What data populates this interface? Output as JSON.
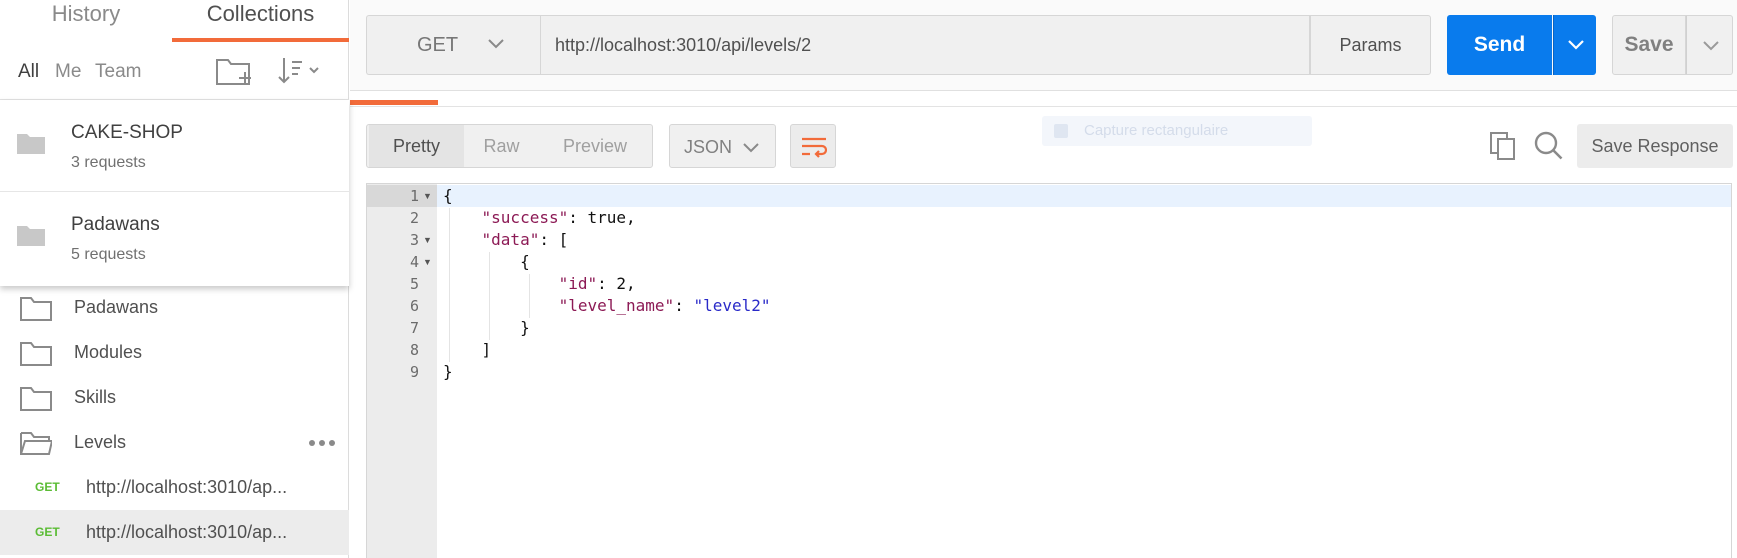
{
  "sidebar": {
    "tabs": {
      "history": "History",
      "collections": "Collections"
    },
    "filters": {
      "all": "All",
      "me": "Me",
      "team": "Team"
    },
    "dropdown": [
      {
        "name": "CAKE-SHOP",
        "count": "3 requests"
      },
      {
        "name": "Padawans",
        "count": "5 requests"
      }
    ],
    "folders": [
      {
        "label": "Padawans"
      },
      {
        "label": "Modules"
      },
      {
        "label": "Skills"
      },
      {
        "label": "Levels"
      }
    ],
    "requests": [
      {
        "method": "GET",
        "url": "http://localhost:3010/ap..."
      },
      {
        "method": "GET",
        "url": "http://localhost:3010/ap..."
      }
    ]
  },
  "request": {
    "method": "GET",
    "url": "http://localhost:3010/api/levels/2",
    "params_label": "Params",
    "send_label": "Send",
    "save_label": "Save"
  },
  "response": {
    "views": {
      "pretty": "Pretty",
      "raw": "Raw",
      "preview": "Preview"
    },
    "format": "JSON",
    "save_response_label": "Save Response",
    "ghost_tooltip": "Capture rectangulaire",
    "line_numbers": [
      "1",
      "2",
      "3",
      "4",
      "5",
      "6",
      "7",
      "8",
      "9"
    ]
  },
  "colors": {
    "accent_orange": "#f26b3a",
    "send_blue": "#097bed",
    "get_green": "#5bbc35",
    "json_key": "#8c1a55",
    "json_string": "#2a2ac8"
  }
}
